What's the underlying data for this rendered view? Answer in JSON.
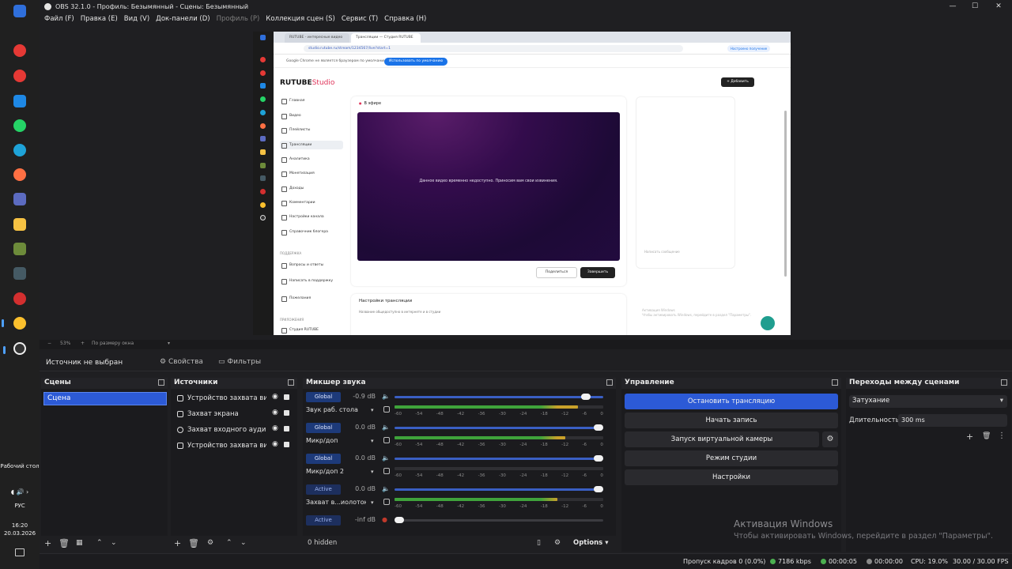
{
  "window": {
    "title": "OBS 32.1.0 - Профиль: Безымянный - Сцены: Безымянный",
    "controls": {
      "minimize": "—",
      "maximize": "☐",
      "close": "✕"
    }
  },
  "menu": [
    "Файл (F)",
    "Правка (E)",
    "Вид (V)",
    "Док-панели (D)",
    "Профиль (P)",
    "Коллекция сцен (S)",
    "Сервис (T)",
    "Справка (H)"
  ],
  "taskbar": {
    "desktop_label": "Рабочий стол",
    "lang": "РУС",
    "time": "16:20",
    "date": "20.03.2026"
  },
  "preview": {
    "browser": {
      "tabs": [
        "RUTUBE - интересные видео",
        "Трансляции — Студия RUTUBE"
      ],
      "url": "studio.rutube.ru/stream/1234567/live?start=1",
      "url_tag": "Настроено получение",
      "infobar_text": "Google Chrome не является браузером по умолчанию",
      "infobar_button": "Использовать по умолчанию"
    },
    "studio": {
      "logo": "RUTUBE",
      "logo_suffix": "Studio",
      "nav": [
        "Главная",
        "Видео",
        "Плейлисты",
        "Трансляции",
        "Аналитика",
        "Монетизация",
        "Доходы",
        "Комментарии",
        "Настройки канала",
        "Справочник блогера"
      ],
      "section_support": "ПОДДЕРЖКА",
      "support_items": [
        "Вопросы и ответы",
        "Написать в поддержку",
        "Пожелания"
      ],
      "section_apps": "ПРИЛОЖЕНИЯ",
      "apps_item": "Студия RUTUBE",
      "live_header": "В эфире",
      "video_message": "Данное видео временно недоступно. Приносим вам свои извинения.",
      "share_button": "Поделиться",
      "end_button": "Завершить",
      "settings_header": "Настройки трансляции",
      "settings_sub": "Название\nобщедоступно в интернете и в студии",
      "add_button": "+ Добавить",
      "chat_placeholder": "Написать сообщение",
      "watermark_title": "Активация Windows",
      "watermark_sub": "Чтобы активировать Windows, перейдите в раздел \"Параметры\"."
    },
    "footer": {
      "zoom": "53%",
      "scale_mode": "По размеру окна"
    }
  },
  "context_bar": {
    "source_label": "Источник не выбран",
    "properties": "Свойства",
    "filters": "Фильтры"
  },
  "scenes": {
    "title": "Сцены",
    "items": [
      "Сцена"
    ]
  },
  "sources": {
    "title": "Источники",
    "items": [
      {
        "label": "Устройство захвата видео",
        "icon": "camera-icon"
      },
      {
        "label": "Захват экрана",
        "icon": "monitor-icon"
      },
      {
        "label": "Захват входного аудио",
        "icon": "mic-icon"
      },
      {
        "label": "Устройство захвата видео",
        "icon": "camera-icon"
      }
    ]
  },
  "mixer": {
    "title": "Микшер звука",
    "ticks": [
      "-60",
      "-54",
      "-48",
      "-42",
      "-36",
      "-30",
      "-24",
      "-18",
      "-12",
      "-6",
      "0"
    ],
    "channels": [
      {
        "badge": "Global",
        "db": "-0.9 dB",
        "name": "Звук раб. стола",
        "volume": 0.94,
        "level": 0.88
      },
      {
        "badge": "Global",
        "db": "0.0 dB",
        "name": "Микр/доп",
        "volume": 1.0,
        "level": 0.82
      },
      {
        "badge": "Global",
        "db": "0.0 dB",
        "name": "Микр/доп 2",
        "volume": 1.0,
        "level": 0.0
      },
      {
        "badge": "Active",
        "db": "0.0 dB",
        "name": "Захват в...иолотока",
        "volume": 1.0,
        "level": 0.78
      },
      {
        "badge": "Active",
        "db": "-inf dB",
        "name": "",
        "volume": 0.0,
        "level": 0.0
      }
    ],
    "hidden": "0 hidden",
    "options": "Options"
  },
  "controls": {
    "title": "Управление",
    "buttons": [
      "Остановить трансляцию",
      "Начать запись",
      "Запуск виртуальной камеры",
      "Режим студии",
      "Настройки"
    ]
  },
  "transitions": {
    "title": "Переходы между сценами",
    "selected": "Затухание",
    "duration_label": "Длительность",
    "duration": "300 ms"
  },
  "status": {
    "dropped": "Пропуск кадров 0 (0.0%)",
    "bitrate": "7186 kbps",
    "stream_time": "00:00:05",
    "rec_time": "00:00:00",
    "cpu": "CPU: 19.0%",
    "fps": "30.00 / 30.00 FPS"
  },
  "watermark": {
    "title": "Активация Windows",
    "subtitle": "Чтобы активировать Windows, перейдите в раздел \"Параметры\"."
  },
  "colors": {
    "accent": "#2c5ad6",
    "live_red": "#e0345a",
    "stream_green": "#4caf50",
    "rec_gray": "#8a8a8a"
  }
}
